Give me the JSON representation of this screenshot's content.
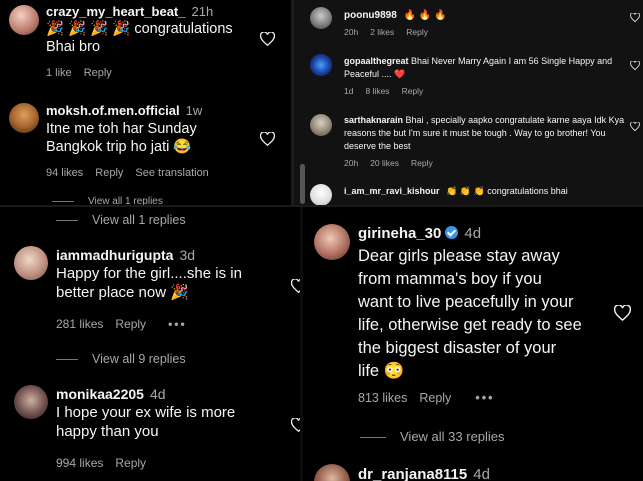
{
  "p1": {
    "c1": {
      "username": "crazy_my_heart_beat_",
      "time": "21h",
      "text_line1": "🎉 🎉 🎉 🎉 congratulations",
      "text_line2": "Bhai bro",
      "likes": "1 like",
      "reply": "Reply"
    },
    "c2": {
      "username": "moksh.of.men.official",
      "time": "1w",
      "text_line1": "Itne me toh har Sunday",
      "text_line2": "Bangkok trip ho jati 😂",
      "likes": "94 likes",
      "reply": "Reply",
      "translate": "See translation"
    },
    "partial": "View all 1 replies"
  },
  "p2": {
    "c1": {
      "username": "poonu9898",
      "text": "🔥 🔥 🔥",
      "time": "20h",
      "likes": "2 likes",
      "reply": "Reply"
    },
    "c2": {
      "username": "gopaalthegreat",
      "text": "Bhai Never Marry Again I am 56 Single Happy and Peaceful .... ❤️",
      "time": "1d",
      "likes": "8 likes",
      "reply": "Reply"
    },
    "c3": {
      "username": "sarthaknarain",
      "text": "Bhai , specially aapko congratulate karne aaya Idk Kya reasons the but I'm sure it must be tough . Way to go brother! You deserve the best",
      "time": "20h",
      "likes": "20 likes",
      "reply": "Reply"
    },
    "c4": {
      "username": "i_am_mr_ravi_kishour",
      "text": "👏 👏 👏 congratulations bhai"
    }
  },
  "p3": {
    "view1": "View all 1 replies",
    "c1": {
      "username": "iammadhurigupta",
      "time": "3d",
      "text_line1": "Happy for the girl....she is in",
      "text_line2": "better place now 🎉",
      "likes": "281 likes",
      "reply": "Reply",
      "more": "•••"
    },
    "view2": "View all 9 replies",
    "c2": {
      "username": "monikaa2205",
      "time": "4d",
      "text_line1": "I hope your ex wife is more",
      "text_line2": "happy than you",
      "likes": "994 likes",
      "reply": "Reply"
    }
  },
  "p4": {
    "c1": {
      "username": "girineha_30",
      "time": "4d",
      "text_line1": "Dear girls please stay away",
      "text_line2": "from mamma's boy if you",
      "text_line3": "want to live peacefully in your",
      "text_line4": "life, otherwise get ready to see",
      "text_line5": "the biggest disaster of your",
      "text_line6": "life 😳",
      "likes": "813 likes",
      "reply": "Reply",
      "more": "•••"
    },
    "view": "View all 33 replies",
    "c2": {
      "username": "dr_ranjana8115",
      "time": "4d"
    }
  },
  "colors": {
    "text": "#f5f5f5",
    "muted": "#a8a8a8",
    "verified": "#3797f0",
    "heart_emoji": "#ff3040"
  }
}
